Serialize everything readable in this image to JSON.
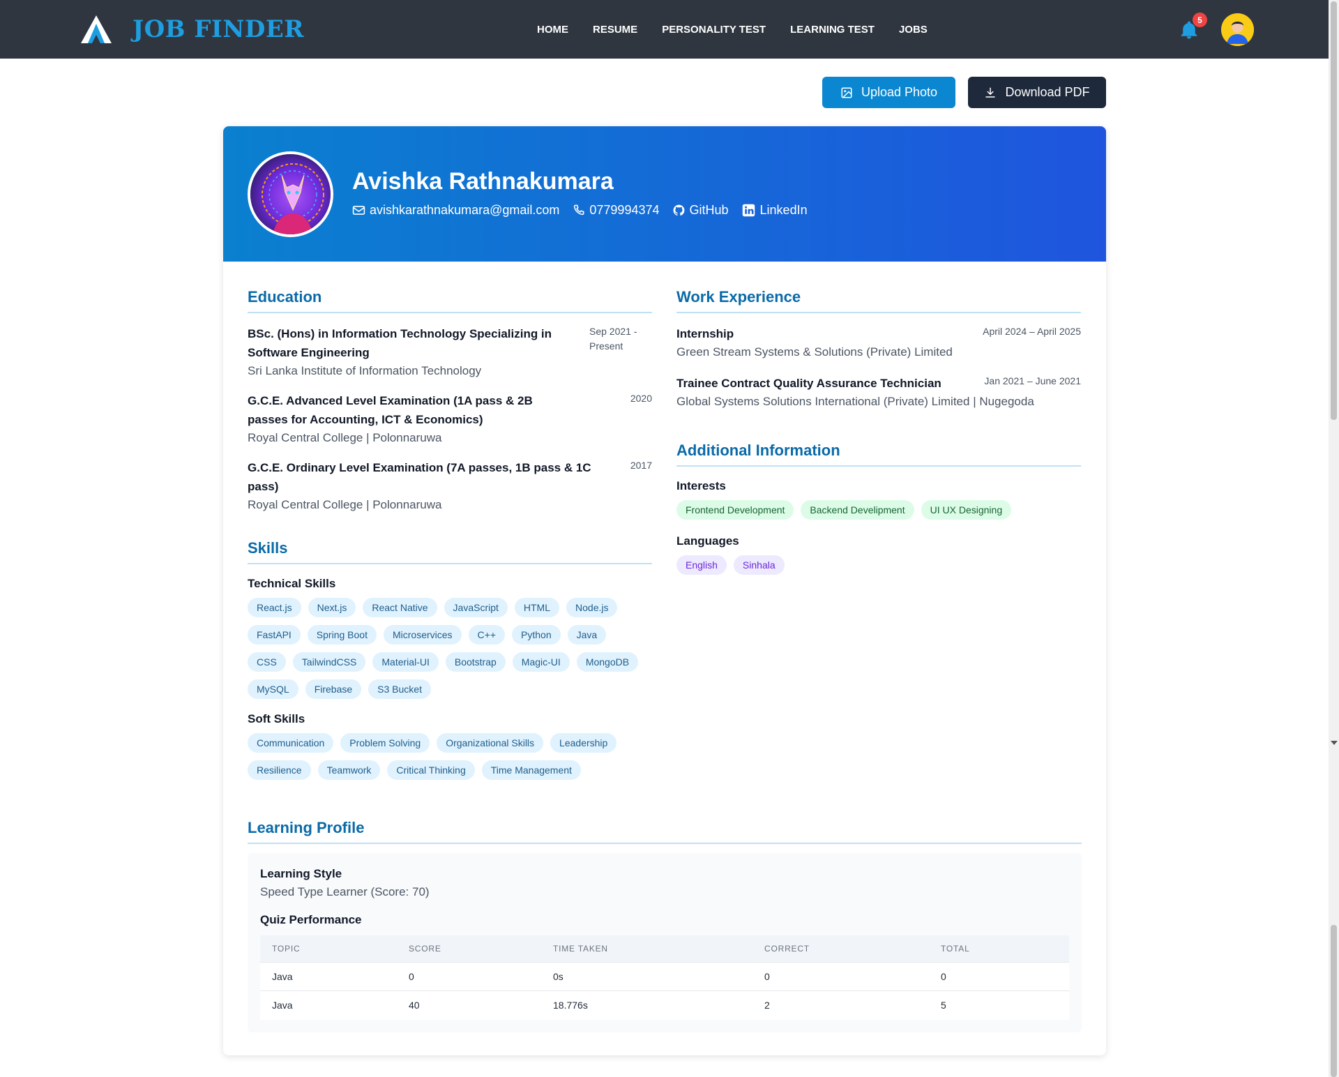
{
  "brand": {
    "name": "JOB FINDER"
  },
  "nav": [
    {
      "label": "HOME"
    },
    {
      "label": "RESUME"
    },
    {
      "label": "PERSONALITY TEST"
    },
    {
      "label": "LEARNING TEST"
    },
    {
      "label": "JOBS"
    }
  ],
  "notifications": {
    "count": "5"
  },
  "actions": {
    "upload_label": "Upload Photo",
    "download_label": "Download PDF"
  },
  "profile": {
    "name": "Avishka Rathnakumara",
    "email": "avishkarathnakumara@gmail.com",
    "phone": "0779994374",
    "github": "GitHub",
    "linkedin": "LinkedIn"
  },
  "education": {
    "title": "Education",
    "items": [
      {
        "degree": "BSc. (Hons) in Information Technology Specializing in Software Engineering",
        "school": "Sri Lanka Institute of Information Technology",
        "date": "Sep 2021 - Present"
      },
      {
        "degree": "G.C.E. Advanced Level Examination (1A pass & 2B passes for Accounting, ICT & Economics)",
        "school": "Royal Central College | Polonnaruwa",
        "date": "2020"
      },
      {
        "degree": "G.C.E. Ordinary Level Examination (7A passes, 1B pass & 1C pass)",
        "school": "Royal Central College | Polonnaruwa",
        "date": "2017"
      }
    ]
  },
  "skills": {
    "title": "Skills",
    "technical_label": "Technical Skills",
    "technical": [
      "React.js",
      "Next.js",
      "React Native",
      "JavaScript",
      "HTML",
      "Node.js",
      "FastAPI",
      "Spring Boot",
      "Microservices",
      "C++",
      "Python",
      "Java",
      "CSS",
      "TailwindCSS",
      "Material-UI",
      "Bootstrap",
      "Magic-UI",
      "MongoDB",
      "MySQL",
      "Firebase",
      "S3 Bucket"
    ],
    "soft_label": "Soft Skills",
    "soft": [
      "Communication",
      "Problem Solving",
      "Organizational Skills",
      "Leadership",
      "Resilience",
      "Teamwork",
      "Critical Thinking",
      "Time Management"
    ]
  },
  "work": {
    "title": "Work Experience",
    "items": [
      {
        "role": "Internship",
        "company": "Green Stream Systems & Solutions (Private) Limited",
        "date": "April 2024 – April 2025"
      },
      {
        "role": "Trainee Contract Quality Assurance Technician",
        "company": "Global Systems Solutions International (Private) Limited | Nugegoda",
        "date": "Jan 2021 – June 2021"
      }
    ]
  },
  "additional": {
    "title": "Additional Information",
    "interests_label": "Interests",
    "interests": [
      "Frontend Development",
      "Backend Develipment",
      "UI UX Designing"
    ],
    "languages_label": "Languages",
    "languages": [
      "English",
      "Sinhala"
    ]
  },
  "learning": {
    "title": "Learning Profile",
    "style_label": "Learning Style",
    "style_value": "Speed Type Learner (Score: 70)",
    "quiz_label": "Quiz Performance",
    "columns": [
      "TOPIC",
      "SCORE",
      "TIME TAKEN",
      "CORRECT",
      "TOTAL"
    ],
    "rows": [
      [
        "Java",
        "0",
        "0s",
        "0",
        "0"
      ],
      [
        "Java",
        "40",
        "18.776s",
        "2",
        "5"
      ]
    ]
  },
  "colors": {
    "navbar": "#2f3640",
    "brand": "#1e9ee0",
    "accent": "#0b87d1",
    "header_start": "#0a80cf",
    "header_end": "#1f55de",
    "section_title": "#0a6aa8"
  }
}
